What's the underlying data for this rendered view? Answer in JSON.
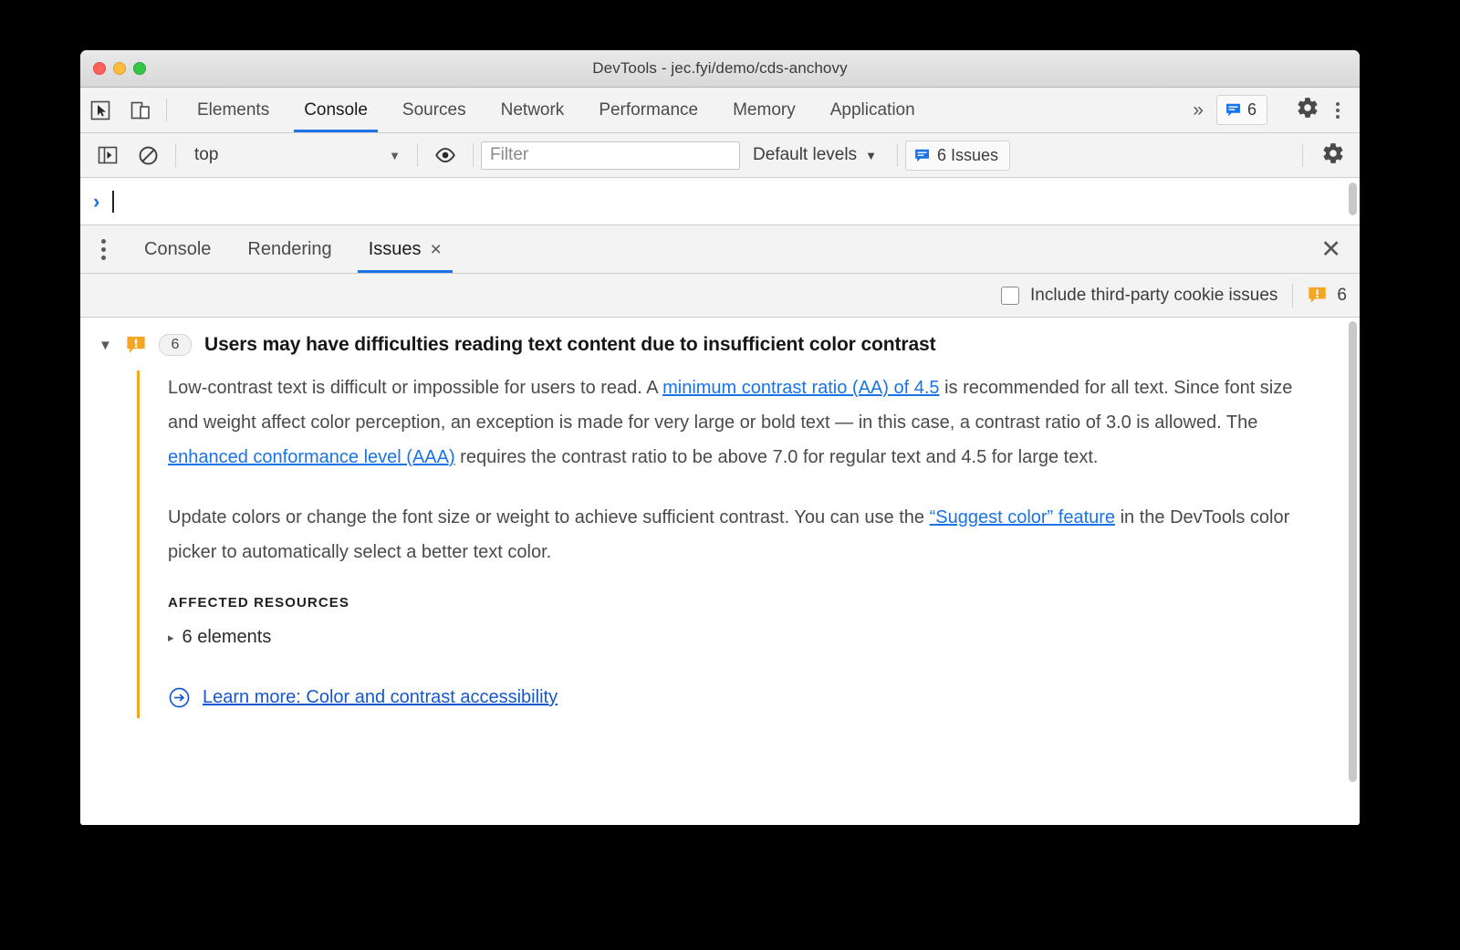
{
  "window": {
    "title": "DevTools - jec.fyi/demo/cds-anchovy",
    "traffic_lights": [
      "close",
      "minimize",
      "maximize"
    ]
  },
  "main_tabbar": {
    "inspect_icon": "cursor-select-icon",
    "device_icon": "device-toolbar-icon",
    "tabs": [
      {
        "label": "Elements",
        "active": false
      },
      {
        "label": "Console",
        "active": true
      },
      {
        "label": "Sources",
        "active": false
      },
      {
        "label": "Network",
        "active": false
      },
      {
        "label": "Performance",
        "active": false
      },
      {
        "label": "Memory",
        "active": false
      },
      {
        "label": "Application",
        "active": false
      }
    ],
    "overflow_label": "»",
    "issues_badge": {
      "icon": "issue-message-icon",
      "count": "6"
    },
    "settings_icon": "gear-icon",
    "more_icon": "kebab-menu-icon"
  },
  "filterbar": {
    "sidebar_toggle_icon": "console-sidebar-icon",
    "clear_icon": "clear-console-icon",
    "context": {
      "value": "top",
      "caret": "▼"
    },
    "eye_icon": "live-expression-icon",
    "filter": {
      "value": "",
      "placeholder": "Filter"
    },
    "levels": {
      "label": "Default levels",
      "caret": "▼"
    },
    "issues_button": {
      "icon": "issue-message-icon",
      "label": "6 Issues"
    },
    "settings_icon": "gear-icon"
  },
  "console_prompt": {
    "arrow": "›",
    "value": ""
  },
  "drawer": {
    "menu_icon": "drawer-menu-icon",
    "tabs": [
      {
        "label": "Console",
        "active": false,
        "closable": false
      },
      {
        "label": "Rendering",
        "active": false,
        "closable": false
      },
      {
        "label": "Issues",
        "active": true,
        "closable": true,
        "close_glyph": "×"
      }
    ],
    "close_glyph": "✕"
  },
  "issues_toolbar": {
    "third_party_label": "Include third-party cookie issues",
    "third_party_checked": false,
    "warning_icon": "warning-issue-icon",
    "issue_count": "6"
  },
  "issue": {
    "toggle_glyph": "▼",
    "warning_icon": "warning-issue-icon",
    "count": "6",
    "title": "Users may have difficulties reading text content due to insufficient color contrast",
    "paragraph1": {
      "part1": "Low-contrast text is difficult or impossible for users to read. A ",
      "link1": "minimum contrast ratio (AA) of 4.5",
      "part2": " is recommended for all text. Since font size and weight affect color perception, an exception is made for very large or bold text — in this case, a contrast ratio of 3.0 is allowed. The ",
      "link2": "enhanced conformance level (AAA)",
      "part3": " requires the contrast ratio to be above 7.0 for regular text and 4.5 for large text."
    },
    "paragraph2": {
      "part1": "Update colors or change the font size or weight to achieve sufficient contrast. You can use the ",
      "link1": "“Suggest color” feature",
      "part2": " in the DevTools color picker to automatically select a better text color."
    },
    "affected_resources_title": "AFFECTED RESOURCES",
    "affected_toggle_glyph": "▸",
    "affected_label": "6 elements",
    "learn_more_icon": "external-link-circle-icon",
    "learn_more_label": "Learn more: Color and contrast accessibility"
  },
  "colors": {
    "accent_blue": "#1a73e8",
    "link_blue": "#1557d0",
    "warning_orange": "#f5a623",
    "toolbar_bg": "#f3f3f3"
  }
}
